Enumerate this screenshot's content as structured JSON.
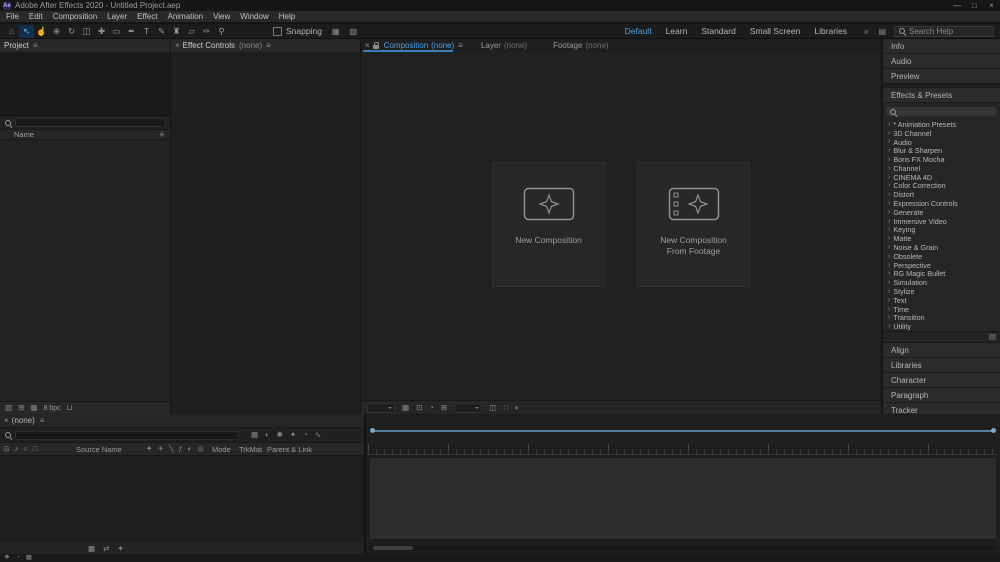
{
  "titlebar": {
    "title": "Adobe After Effects 2020 - Untitled Project.aep"
  },
  "icons": {
    "logo": "Ae",
    "minimize": "—",
    "maximize": "□",
    "close": "×",
    "panel_menu": "≡",
    "tab_close": "×",
    "chevron": "›",
    "overflow": "»",
    "keyboard_shortcuts": "▤",
    "snap_extra_a": "▦",
    "snap_extra_b": "▧",
    "interpret_footage": "▥",
    "create_folder": "⊞",
    "create_comp": "▦",
    "project_flowchart": "✳",
    "trash": "⊔",
    "effects_panel_options": "▤"
  },
  "menubar": {
    "items": [
      {
        "name": "menu-file",
        "label": "File"
      },
      {
        "name": "menu-edit",
        "label": "Edit"
      },
      {
        "name": "menu-composition",
        "label": "Composition"
      },
      {
        "name": "menu-layer",
        "label": "Layer"
      },
      {
        "name": "menu-effect",
        "label": "Effect"
      },
      {
        "name": "menu-animation",
        "label": "Animation"
      },
      {
        "name": "menu-view",
        "label": "View"
      },
      {
        "name": "menu-window",
        "label": "Window"
      },
      {
        "name": "menu-help",
        "label": "Help"
      }
    ]
  },
  "toolbar": {
    "tools": [
      {
        "name": "home-button",
        "glyph": "⌂"
      },
      {
        "name": "selection-tool",
        "glyph": "↖",
        "active": true
      },
      {
        "name": "hand-tool",
        "glyph": "☝"
      },
      {
        "name": "zoom-tool",
        "glyph": "⊕"
      },
      {
        "name": "orbit-camera-tool",
        "glyph": "↻"
      },
      {
        "name": "camera-tool",
        "glyph": "◫"
      },
      {
        "name": "pan-behind-tool",
        "glyph": "✚"
      },
      {
        "name": "shape-tool",
        "glyph": "▭"
      },
      {
        "name": "pen-tool",
        "glyph": "✒"
      },
      {
        "name": "type-tool",
        "glyph": "T"
      },
      {
        "name": "brush-tool",
        "glyph": "✎"
      },
      {
        "name": "clone-stamp-tool",
        "glyph": "♜"
      },
      {
        "name": "eraser-tool",
        "glyph": "▱"
      },
      {
        "name": "roto-brush-tool",
        "glyph": "✑"
      },
      {
        "name": "puppet-pin-tool",
        "glyph": "⚲"
      }
    ],
    "snapping_label": "Snapping",
    "workspaces": [
      {
        "name": "workspace-default",
        "label": "Default",
        "active": true
      },
      {
        "name": "workspace-learn",
        "label": "Learn"
      },
      {
        "name": "workspace-standard",
        "label": "Standard"
      },
      {
        "name": "workspace-small-screen",
        "label": "Small Screen"
      },
      {
        "name": "workspace-libraries",
        "label": "Libraries"
      }
    ],
    "search_placeholder": "Search Help"
  },
  "project_panel": {
    "title": "Project",
    "name_column": "Name",
    "bit_depth": "8 bpc"
  },
  "effect_controls_panel": {
    "title": "Effect Controls",
    "target": "(none)"
  },
  "viewer": {
    "tabs": [
      {
        "label": "Composition",
        "target": "(none)"
      },
      {
        "label": "Layer",
        "target": "(none)"
      },
      {
        "label": "Footage",
        "target": "(none)"
      }
    ],
    "actions": [
      {
        "label": "New Composition"
      },
      {
        "label": "New Composition From Footage"
      }
    ],
    "footer_icons_a": [
      {
        "name": "grid-guides-icon",
        "glyph": "▦"
      },
      {
        "name": "mask-visibility-icon",
        "glyph": "⊡"
      },
      {
        "name": "region-of-interest-icon",
        "glyph": "◔"
      },
      {
        "name": "transparency-grid-icon",
        "glyph": "⊞"
      }
    ],
    "footer_icons_b": [
      {
        "name": "camera-view-icon",
        "glyph": "◫"
      },
      {
        "name": "pixel-aspect-icon",
        "glyph": "∷"
      },
      {
        "name": "exposure-icon",
        "glyph": "◐"
      }
    ]
  },
  "sidebar": {
    "panels_top": [
      {
        "name": "panel-info",
        "label": "Info"
      },
      {
        "name": "panel-audio",
        "label": "Audio"
      },
      {
        "name": "panel-preview",
        "label": "Preview"
      }
    ],
    "effects_presets": {
      "title": "Effects & Presets",
      "categories": [
        "* Animation Presets",
        "3D Channel",
        "Audio",
        "Blur & Sharpen",
        "Boris FX Mocha",
        "Channel",
        "CINEMA 4D",
        "Color Correction",
        "Distort",
        "Expression Controls",
        "Generate",
        "Immersive Video",
        "Keying",
        "Matte",
        "Noise & Grain",
        "Obsolete",
        "Perspective",
        "RG Magic Bullet",
        "Simulation",
        "Stylize",
        "Text",
        "Time",
        "Transition",
        "Utility"
      ]
    },
    "panels_bottom": [
      {
        "name": "panel-align",
        "label": "Align"
      },
      {
        "name": "panel-libraries",
        "label": "Libraries"
      },
      {
        "name": "panel-character",
        "label": "Character"
      },
      {
        "name": "panel-paragraph",
        "label": "Paragraph"
      },
      {
        "name": "panel-tracker",
        "label": "Tracker"
      }
    ]
  },
  "timeline": {
    "tab_label": "(none)",
    "columns": {
      "source_name": "Source Name",
      "mode": "Mode",
      "trkmat": "TrkMat",
      "parent": "Parent & Link"
    },
    "left_icons": [
      {
        "name": "video-toggle-icon",
        "glyph": "◎"
      },
      {
        "name": "audio-toggle-icon",
        "glyph": "♪"
      },
      {
        "name": "solo-toggle-icon",
        "glyph": "○"
      },
      {
        "name": "lock-toggle-icon",
        "glyph": "□"
      }
    ],
    "switch_icons": [
      {
        "name": "shy-icon",
        "glyph": "✦"
      },
      {
        "name": "collapse-transformations-icon",
        "glyph": "☀"
      },
      {
        "name": "quality-icon",
        "glyph": "╲"
      },
      {
        "name": "effects-icon",
        "glyph": "ƒ"
      },
      {
        "name": "motion-blur-icon",
        "glyph": "◐"
      },
      {
        "name": "adjustment-layer-icon",
        "glyph": "◎"
      }
    ],
    "toolbar_icons": [
      {
        "name": "comp-mini-flowchart-icon",
        "glyph": "▦"
      },
      {
        "name": "draft-3d-icon",
        "glyph": "◐"
      },
      {
        "name": "hide-shy-layers-icon",
        "glyph": "✺"
      },
      {
        "name": "frame-blending-icon",
        "glyph": "✦"
      },
      {
        "name": "motion-blur-toggle-icon",
        "glyph": "◔"
      },
      {
        "name": "graph-editor-icon",
        "glyph": "∿"
      }
    ],
    "footer_icons": [
      {
        "name": "expand-layer-switches-icon",
        "glyph": "▩"
      },
      {
        "name": "toggle-switches-modes-icon",
        "glyph": "⇄"
      },
      {
        "name": "transfer-controls-icon",
        "glyph": "✦"
      }
    ]
  },
  "statusbar": {
    "icons": [
      {
        "name": "status-icon-a",
        "glyph": "❖"
      },
      {
        "name": "status-icon-b",
        "glyph": "◔"
      },
      {
        "name": "status-icon-c",
        "glyph": "▦"
      }
    ]
  },
  "colors": {
    "accent_blue": "#4da1e0",
    "navigator_blue": "#56809f"
  }
}
